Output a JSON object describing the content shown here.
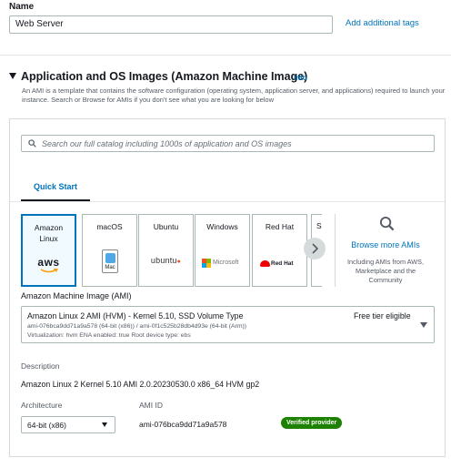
{
  "name_section": {
    "label": "Name",
    "value": "Web Server",
    "add_tags_link": "Add additional tags"
  },
  "ami_section": {
    "title": "Application and OS Images (Amazon Machine Image)",
    "info_link": "Info",
    "description": "An AMI is a template that contains the software configuration (operating system, application server, and applications) required to launch your instance. Search or Browse for AMIs if you don't see what you are looking for below"
  },
  "search": {
    "placeholder": "Search our full catalog including 1000s of application and OS images"
  },
  "tabs": [
    {
      "label": "Quick Start",
      "selected": true
    }
  ],
  "os_cards": [
    {
      "name": "Amazon Linux",
      "logo_text": "aws",
      "icon": "aws-logo",
      "selected": true
    },
    {
      "name": "macOS",
      "logo_text": "Mac",
      "icon": "mac-logo",
      "selected": false
    },
    {
      "name": "Ubuntu",
      "logo_text": "ubuntu",
      "icon": "ubuntu-logo",
      "selected": false
    },
    {
      "name": "Windows",
      "logo_text": "Microsoft",
      "icon": "microsoft-logo",
      "selected": false
    },
    {
      "name": "Red Hat",
      "logo_text": "Red Hat",
      "icon": "redhat-logo",
      "selected": false
    },
    {
      "name": "S",
      "logo_text": "",
      "icon": "",
      "selected": false
    }
  ],
  "browse_more": {
    "link": "Browse more AMIs",
    "subtext": "Including AMIs from AWS, Marketplace and the Community",
    "icon": "search-icon"
  },
  "ami_select": {
    "label": "Amazon Machine Image (AMI)",
    "name": "Amazon Linux 2 AMI (HVM) - Kernel 5.10, SSD Volume Type",
    "ids": "ami-076bca9dd71a9a578 (64-bit (x86)) / ami-0f1c525b28db4d93e (64-bit (Arm))",
    "meta": "Virtualization: hvm     ENA enabled: true     Root device type: ebs",
    "free_tier": "Free tier eligible"
  },
  "details": {
    "description_label": "Description",
    "description_value": "Amazon Linux 2 Kernel 5.10 AMI 2.0.20230530.0 x86_64 HVM gp2",
    "architecture_label": "Architecture",
    "architecture_value": "64-bit (x86)",
    "ami_id_label": "AMI ID",
    "ami_id_value": "ami-076bca9dd71a9a578",
    "verified_badge": "Verified provider"
  },
  "colors": {
    "link": "#0073bb",
    "selected_border": "#0073bb",
    "verified_bg": "#1d8102",
    "text": "#16191f",
    "muted": "#545b64"
  }
}
